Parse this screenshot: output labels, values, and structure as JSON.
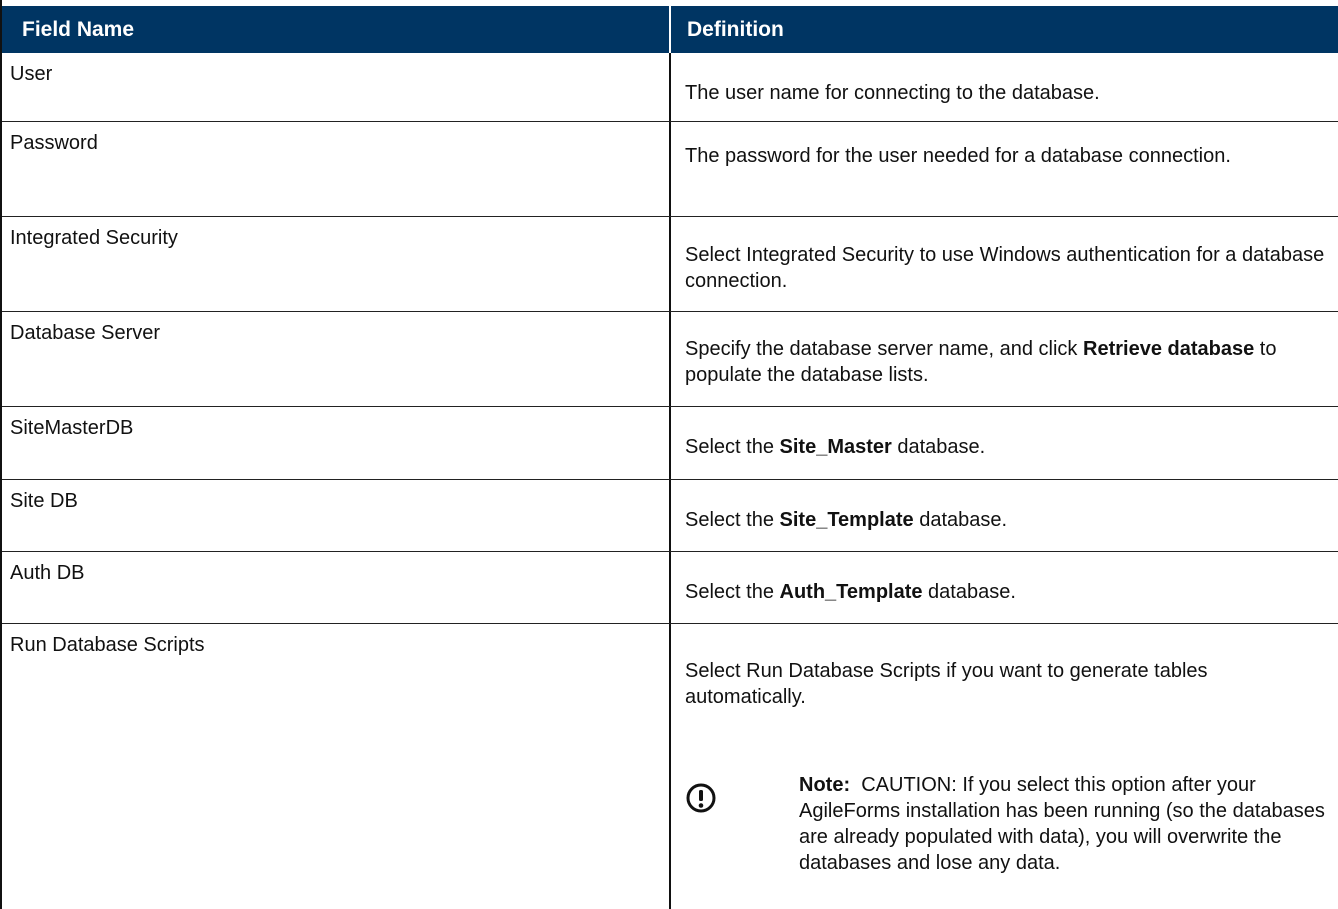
{
  "header": {
    "col1": "Field Name",
    "col2": "Definition"
  },
  "rows": [
    {
      "name": "User",
      "definition": "The user name for connecting to the database."
    },
    {
      "name": "Password",
      "definition": "The password for the user needed for a database connection."
    },
    {
      "name": "Integrated Security",
      "definition": "Select Integrated Security to use Windows authentication for a database connection."
    },
    {
      "name": "Database Server",
      "def_pre": "Specify the database server name, and click ",
      "def_bold": "Retrieve database",
      "def_post": " to populate the database lists."
    },
    {
      "name": "SiteMasterDB",
      "def_pre": "Select the ",
      "def_bold": "Site_Master",
      "def_post": " database."
    },
    {
      "name": "Site DB",
      "def_pre": "Select the ",
      "def_bold": "Site_Template",
      "def_post": " database."
    },
    {
      "name": "Auth DB",
      "def_pre": "Select the ",
      "def_bold": "Auth_Template",
      "def_post": " database."
    },
    {
      "name": "Run Database Scripts",
      "definition": "Select Run Database Scripts if you want to generate tables automatically."
    }
  ],
  "note": {
    "label": "Note:",
    "text": "CAUTION: If you select this option after your AgileForms installation has been running (so the databases are already populated with data), you will overwrite the databases and lose any data.",
    "icon": "caution-icon"
  }
}
